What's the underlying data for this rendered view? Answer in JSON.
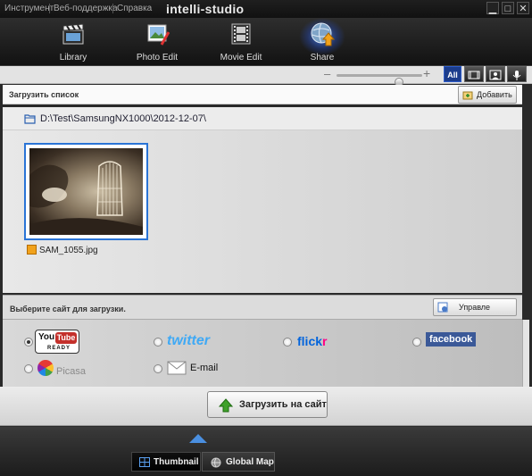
{
  "menubar": {
    "items": [
      "Инструмент",
      "Веб-поддержка",
      "Справка"
    ],
    "app_title": "intelli-studio",
    "window_buttons": [
      "minimize-icon",
      "maximize-icon",
      "close-icon"
    ]
  },
  "toolbar": {
    "items": [
      {
        "label": "Library",
        "icon": "clapperboard-icon"
      },
      {
        "label": "Photo Edit",
        "icon": "photo-edit-icon"
      },
      {
        "label": "Movie Edit",
        "icon": "film-icon"
      },
      {
        "label": "Share",
        "icon": "globe-upload-icon"
      }
    ],
    "active": "Share"
  },
  "viewbar": {
    "zoom_minus": "–",
    "zoom_plus": "+",
    "zoom_level": 0.76,
    "filters": [
      {
        "label": "All",
        "active": true
      },
      {
        "icon": "movie-filter-icon"
      },
      {
        "icon": "person-filter-icon"
      },
      {
        "icon": "mic-filter-icon"
      }
    ]
  },
  "upload_list": {
    "title": "Загрузить список",
    "add_button": "Добавить",
    "path": "D:\\Test\\SamsungNX1000\\2012-12-07\\",
    "files": [
      {
        "name": "SAM_1055.jpg",
        "selected": true
      }
    ]
  },
  "sites": {
    "title": "Выберите сайт для загрузки.",
    "manage_button": "Управле сайтом",
    "options": [
      {
        "name": "YouTube",
        "sub": "READY",
        "selected": true
      },
      {
        "name": "twitter",
        "selected": false
      },
      {
        "name": "flickr",
        "selected": false
      },
      {
        "name": "facebook",
        "selected": false
      },
      {
        "name": "Picasa",
        "selected": false
      },
      {
        "name": "E-mail",
        "selected": false
      }
    ]
  },
  "upload_button": "Загрузить на сайт",
  "bottom_tabs": [
    {
      "label": "Thumbnail",
      "active": true
    },
    {
      "label": "Global Map",
      "active": false
    }
  ],
  "colors": {
    "accent": "#2a74d6",
    "facebook": "#3b5998",
    "twitter": "#3fa9f5",
    "flickr_blue": "#0063dc",
    "flickr_pink": "#ff0084",
    "upload_green": "#3fa12a"
  }
}
